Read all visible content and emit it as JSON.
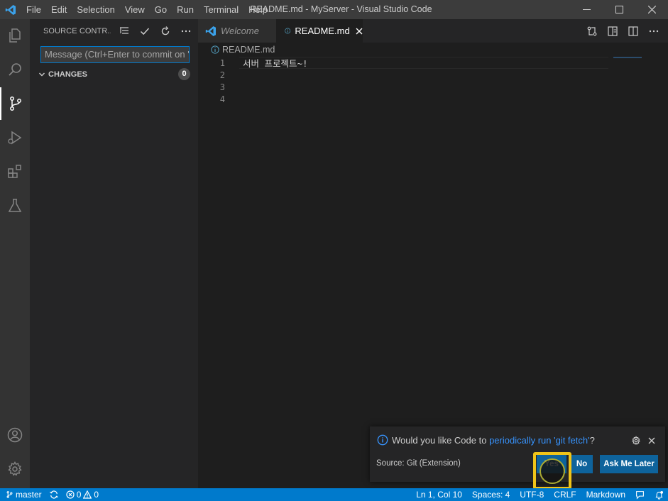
{
  "window": {
    "title": "README.md - MyServer - Visual Studio Code",
    "menu": [
      {
        "label": "File"
      },
      {
        "label": "Edit"
      },
      {
        "label": "Selection"
      },
      {
        "label": "View"
      },
      {
        "label": "Go"
      },
      {
        "label": "Run"
      },
      {
        "label": "Terminal"
      },
      {
        "label": "Help"
      }
    ]
  },
  "activitybar": {
    "items": [
      "explorer-icon",
      "search-icon",
      "source-control-icon",
      "run-debug-icon",
      "extensions-icon",
      "testing-icon"
    ],
    "bottom": [
      "accounts-icon",
      "manage-gear-icon"
    ]
  },
  "sidebar": {
    "title": "SOURCE CONTR...",
    "commit_placeholder": "Message (Ctrl+Enter to commit on '...",
    "changes_label": "CHANGES",
    "changes_count": "0"
  },
  "tabs": [
    {
      "label": "Welcome",
      "active": false
    },
    {
      "label": "README.md",
      "active": true
    }
  ],
  "breadcrumb": {
    "file": "README.md"
  },
  "editor": {
    "lines": [
      {
        "number": "1",
        "text": "서버 프로젝트~!"
      },
      {
        "number": "2",
        "text": ""
      },
      {
        "number": "3",
        "text": ""
      },
      {
        "number": "4",
        "text": ""
      }
    ]
  },
  "notification": {
    "message_prefix": "Would you like Code to ",
    "message_link": "periodically run 'git fetch'",
    "message_suffix": "?",
    "source": "Source: Git (Extension)",
    "buttons": {
      "yes": "Yes",
      "no": "No",
      "later": "Ask Me Later"
    }
  },
  "statusbar": {
    "branch": "master",
    "errors": "0",
    "warnings": "0",
    "position": "Ln 1, Col 10",
    "spaces": "Spaces: 4",
    "encoding": "UTF-8",
    "eol": "CRLF",
    "language": "Markdown"
  },
  "colors": {
    "accent": "#007acc",
    "button": "#0e639c",
    "highlight": "#f0c419",
    "link": "#3794ff"
  }
}
